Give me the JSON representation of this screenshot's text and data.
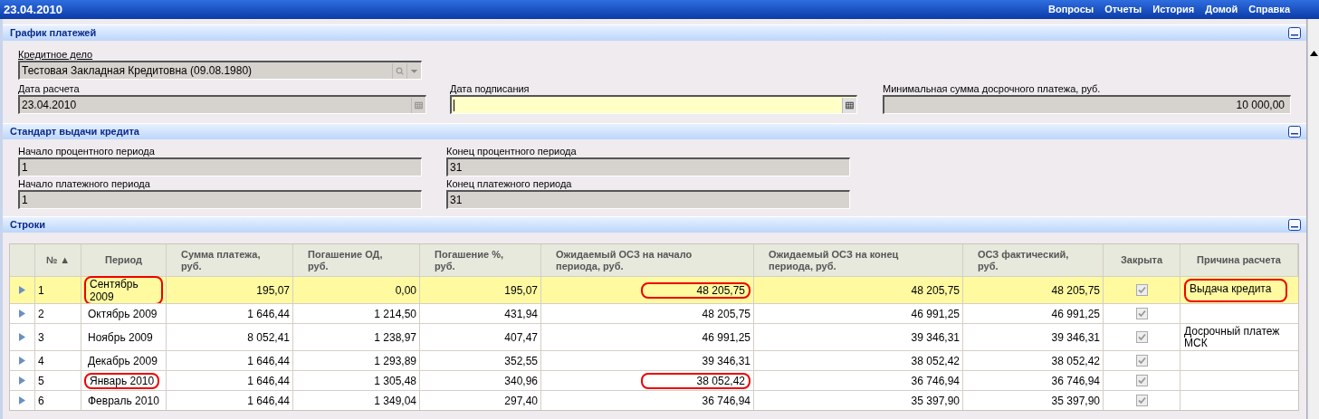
{
  "header": {
    "date": "23.04.2010",
    "nav": [
      "Вопросы",
      "Отчеты",
      "История",
      "Домой",
      "Справка"
    ]
  },
  "schedule": {
    "title": "График платежей",
    "credit_case": {
      "label": "Кредитное дело",
      "value": "Тестовая Закладная Кредитовна (09.08.1980)"
    },
    "calc_date": {
      "label": "Дата расчета",
      "value": "23.04.2010"
    },
    "sign_date": {
      "label": "Дата подписания"
    },
    "min_sum": {
      "label": "Минимальная сумма досрочного платежа, руб.",
      "value": "10 000,00"
    }
  },
  "standard": {
    "title": "Стандарт выдачи кредита",
    "fields": [
      {
        "label": "Начало процентного периода",
        "value": "1"
      },
      {
        "label": "Конец процентного периода",
        "value": "31"
      },
      {
        "label": "Начало платежного периода",
        "value": "1"
      },
      {
        "label": "Конец платежного периода",
        "value": "31"
      }
    ]
  },
  "rows_section": {
    "title": "Строки",
    "columns": [
      "№ ▲",
      "Период",
      "Сумма платежа, руб.",
      "Погашение ОД, руб.",
      "Погашение %, руб.",
      "Ожидаемый ОСЗ на начало периода, руб.",
      "Ожидаемый ОСЗ на конец периода, руб.",
      "ОСЗ фактический, руб.",
      "Закрыта",
      "Причина расчета"
    ],
    "rows": [
      {
        "selected": true,
        "closed": true,
        "cells": [
          {
            "text": "1",
            "circled": false
          },
          {
            "text": "Сентябрь 2009",
            "circled": true
          },
          {
            "text": "195,07",
            "circled": false
          },
          {
            "text": "0,00",
            "circled": false
          },
          {
            "text": "195,07",
            "circled": false
          },
          {
            "text": "48 205,75",
            "circled": true
          },
          {
            "text": "48 205,75",
            "circled": false
          },
          {
            "text": "48 205,75",
            "circled": false
          }
        ],
        "reason": {
          "text": "Выдача кредита",
          "circled": true
        }
      },
      {
        "selected": false,
        "closed": true,
        "cells": [
          {
            "text": "2",
            "circled": false
          },
          {
            "text": "Октябрь 2009",
            "circled": false
          },
          {
            "text": "1 646,44",
            "circled": false
          },
          {
            "text": "1 214,50",
            "circled": false
          },
          {
            "text": "431,94",
            "circled": false
          },
          {
            "text": "48 205,75",
            "circled": false
          },
          {
            "text": "46 991,25",
            "circled": false
          },
          {
            "text": "46 991,25",
            "circled": false
          }
        ]
      },
      {
        "selected": false,
        "closed": true,
        "cells": [
          {
            "text": "3",
            "circled": false
          },
          {
            "text": "Ноябрь 2009",
            "circled": false
          },
          {
            "text": "8 052,41",
            "circled": false
          },
          {
            "text": "1 238,97",
            "circled": false
          },
          {
            "text": "407,47",
            "circled": false
          },
          {
            "text": "46 991,25",
            "circled": false
          },
          {
            "text": "39 346,31",
            "circled": false
          },
          {
            "text": "39 346,31",
            "circled": false
          }
        ],
        "reason": {
          "text": "Досрочный платеж МСК",
          "circled": false
        }
      },
      {
        "selected": false,
        "closed": true,
        "cells": [
          {
            "text": "4",
            "circled": false
          },
          {
            "text": "Декабрь 2009",
            "circled": false
          },
          {
            "text": "1 646,44",
            "circled": false
          },
          {
            "text": "1 293,89",
            "circled": false
          },
          {
            "text": "352,55",
            "circled": false
          },
          {
            "text": "39 346,31",
            "circled": false
          },
          {
            "text": "38 052,42",
            "circled": false
          },
          {
            "text": "38 052,42",
            "circled": false
          }
        ]
      },
      {
        "selected": false,
        "closed": true,
        "cells": [
          {
            "text": "5",
            "circled": false
          },
          {
            "text": "Январь 2010",
            "circled": true
          },
          {
            "text": "1 646,44",
            "circled": false
          },
          {
            "text": "1 305,48",
            "circled": false
          },
          {
            "text": "340,96",
            "circled": false
          },
          {
            "text": "38 052,42",
            "circled": true
          },
          {
            "text": "36 746,94",
            "circled": false
          },
          {
            "text": "36 746,94",
            "circled": false
          }
        ]
      },
      {
        "selected": false,
        "closed": true,
        "cells": [
          {
            "text": "6",
            "circled": false
          },
          {
            "text": "Февраль 2010",
            "circled": false
          },
          {
            "text": "1 646,44",
            "circled": false
          },
          {
            "text": "1 349,04",
            "circled": false
          },
          {
            "text": "297,40",
            "circled": false
          },
          {
            "text": "36 746,94",
            "circled": false
          },
          {
            "text": "35 397,90",
            "circled": false
          },
          {
            "text": "35 397,90",
            "circled": false
          }
        ]
      }
    ]
  }
}
